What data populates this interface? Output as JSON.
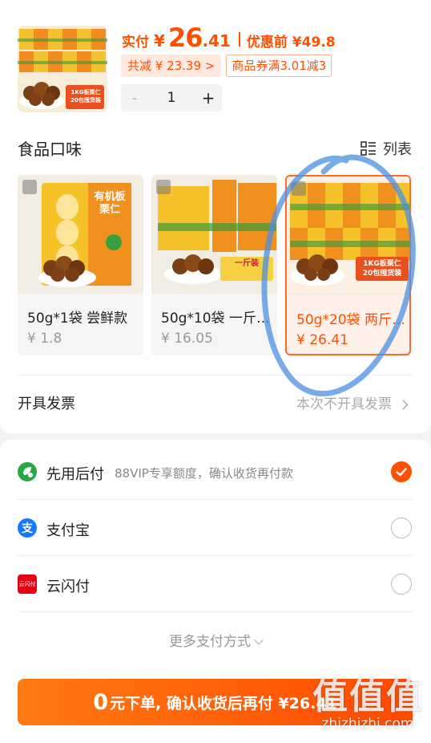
{
  "product": {
    "thumb_badge_line1": "1KG板栗仁",
    "thumb_badge_line2": "20包囤货装",
    "pay_label": "实付",
    "currency": "¥",
    "price_int": "26",
    "price_dec": ".41",
    "orig_price": "优惠前 ¥49.8",
    "discount_chip": "共减 ¥ 23.39 >",
    "coupon_chip": "商品券满3.01减3",
    "quantity": "1",
    "minus": "-",
    "plus": "+"
  },
  "flavor": {
    "title": "食品口味",
    "list_label": "列表",
    "options": [
      {
        "label": "50g*1袋 尝鲜款",
        "price": "¥ 1.8",
        "pkg_text": "有机板栗仁",
        "selected": false
      },
      {
        "label": "50g*10袋 一斤…",
        "price": "¥ 16.05",
        "pkg_text": "一斤装",
        "selected": false
      },
      {
        "label": "50g*20袋 两斤…",
        "price": "¥ 26.41",
        "pkg_text": "1KG板栗仁 20包囤货装",
        "selected": true
      }
    ]
  },
  "invoice": {
    "label": "开具发票",
    "value": "本次不开具发票"
  },
  "payment": {
    "methods": [
      {
        "name": "先用后付",
        "desc": "88VIP专享额度，确认收货再付款",
        "icon": "leaf-pay-icon",
        "selected": true
      },
      {
        "name": "支付宝",
        "desc": "",
        "icon": "alipay-icon",
        "selected": false
      },
      {
        "name": "云闪付",
        "desc": "",
        "icon": "unionpay-icon",
        "selected": false
      }
    ],
    "unionpay_icon_text": "云闪付",
    "more": "更多支付方式"
  },
  "submit": {
    "big": "0",
    "text": "元下单, 确认收货后再付 ¥26.41"
  },
  "watermark": {
    "main": "值值值",
    "sub": "zhizhizhi.com"
  },
  "colors": {
    "accent": "#ff5000",
    "alipay": "#1677ff",
    "leaf_green": "#27a844",
    "unionpay_red": "#e60012"
  }
}
